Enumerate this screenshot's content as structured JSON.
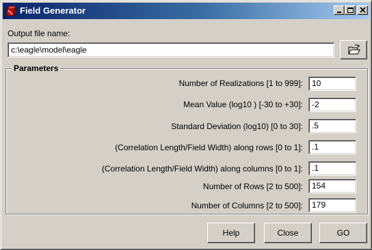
{
  "window": {
    "title": "Field Generator",
    "icon": "app-dice-icon",
    "controls": [
      "minimize-icon",
      "maximize-icon",
      "close-icon"
    ]
  },
  "output": {
    "label": "Output file name:",
    "value": "c:\\eagle\\model\\eagle",
    "browse_icon": "open-folder-icon"
  },
  "parameters": {
    "legend": "Parameters",
    "rows": [
      {
        "label": "Number of Realizations [1 to 999]:",
        "value": "10"
      },
      {
        "label": "Mean Value (log10 ) [-30 to +30]:",
        "value": "-2"
      },
      {
        "label": "Standard Deviation (log10)  [0 to 30]:",
        "value": ".5"
      },
      {
        "label": "(Correlation Length/Field Width) along rows [0 to 1]:",
        "value": ".1"
      },
      {
        "label": "(Correlation Length/Field Width) along columns [0 to 1]:",
        "value": ".1"
      },
      {
        "label": "Number of Rows [2 to 500]:",
        "value": "154"
      },
      {
        "label": "Number of Columns [2 to 500]:",
        "value": "179"
      }
    ]
  },
  "buttons": {
    "help": "Help",
    "close": "Close",
    "go": "GO"
  }
}
